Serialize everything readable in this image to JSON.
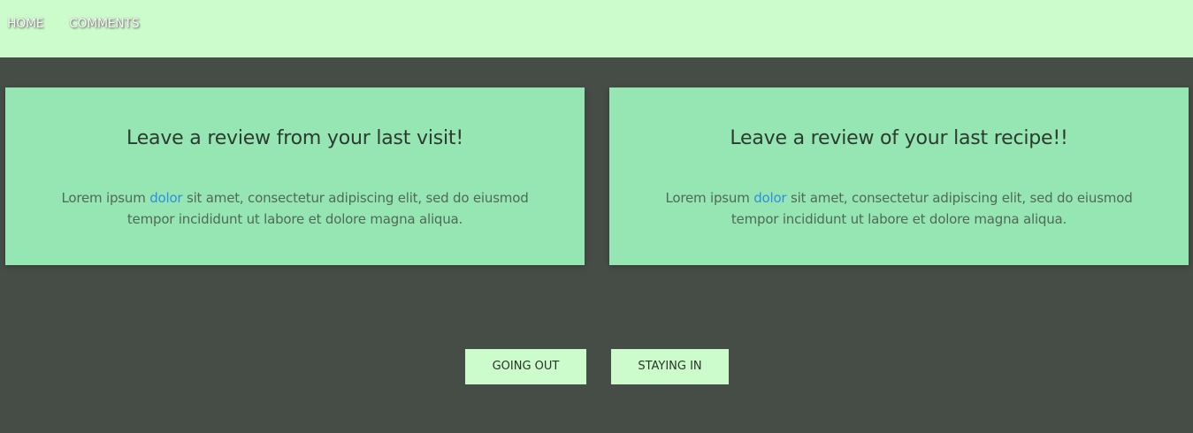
{
  "nav": {
    "items": [
      {
        "label": "HOME"
      },
      {
        "label": "COMMENTS"
      }
    ]
  },
  "cards": [
    {
      "title": "Leave a review from your last visit!",
      "text_before": "Lorem ipsum ",
      "link": "dolor",
      "text_after": " sit amet, consectetur adipiscing elit, sed do eiusmod tempor incididunt ut labore et dolore magna aliqua."
    },
    {
      "title": "Leave a review of your last recipe!!",
      "text_before": "Lorem ipsum ",
      "link": "dolor",
      "text_after": " sit amet, consectetur adipiscing elit, sed do eiusmod tempor incididunt ut labore et dolore magna aliqua."
    }
  ],
  "buttons": {
    "going_out": "GOING OUT",
    "staying_in": "STAYING IN"
  },
  "colors": {
    "page_background": "#464d47",
    "nav_background": "#ccfccb",
    "card_background": "#96e6b3",
    "button_background": "#ccfccb",
    "link": "#2f8ee0"
  }
}
